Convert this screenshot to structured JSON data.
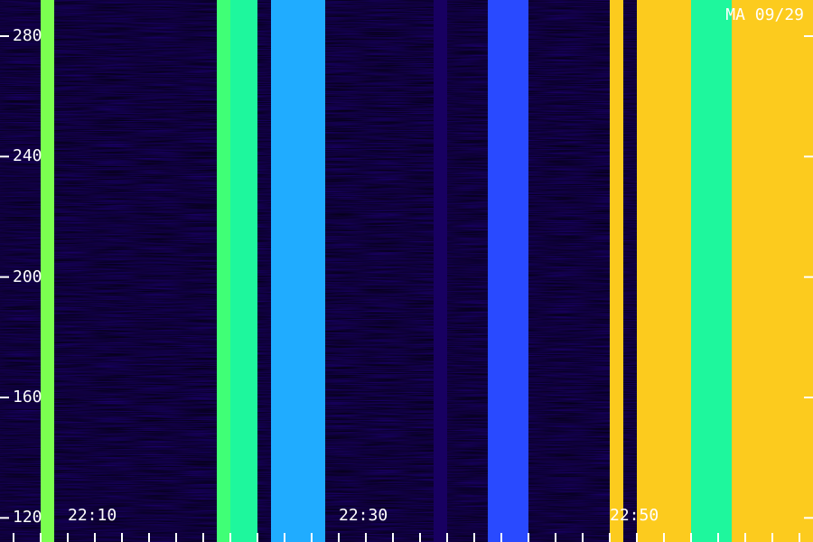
{
  "chart_data": {
    "type": "heatmap",
    "label": "MA 09/29",
    "yticks": [
      120,
      160,
      200,
      240,
      280
    ],
    "ylim": [
      112,
      292
    ],
    "xticks": [
      "22:10",
      "22:30",
      "22:50"
    ],
    "xlim": [
      "22:03",
      "22:63"
    ],
    "colormap": [
      "#000000",
      "#22008a",
      "#2a3cff",
      "#1ec8ff",
      "#1eff8c",
      "#c8ff1e",
      "#ffc81e",
      "#ff3c00"
    ],
    "bands": [
      {
        "start": "22:06",
        "end": "22:07",
        "level": 0.65
      },
      {
        "start": "22:19",
        "end": "22:20",
        "level": 0.6
      },
      {
        "start": "22:20",
        "end": "22:22",
        "level": 0.55
      },
      {
        "start": "22:23",
        "end": "22:27",
        "level": 0.4
      },
      {
        "start": "22:35",
        "end": "22:36",
        "level": 0.1
      },
      {
        "start": "22:39",
        "end": "22:42",
        "level": 0.3
      },
      {
        "start": "22:48",
        "end": "22:49",
        "level": 0.85
      },
      {
        "start": "22:50",
        "end": "22:54",
        "level": 0.85
      },
      {
        "start": "22:54",
        "end": "22:57",
        "level": 0.55
      },
      {
        "start": "22:57",
        "end": "22:63",
        "level": 0.85
      }
    ]
  }
}
